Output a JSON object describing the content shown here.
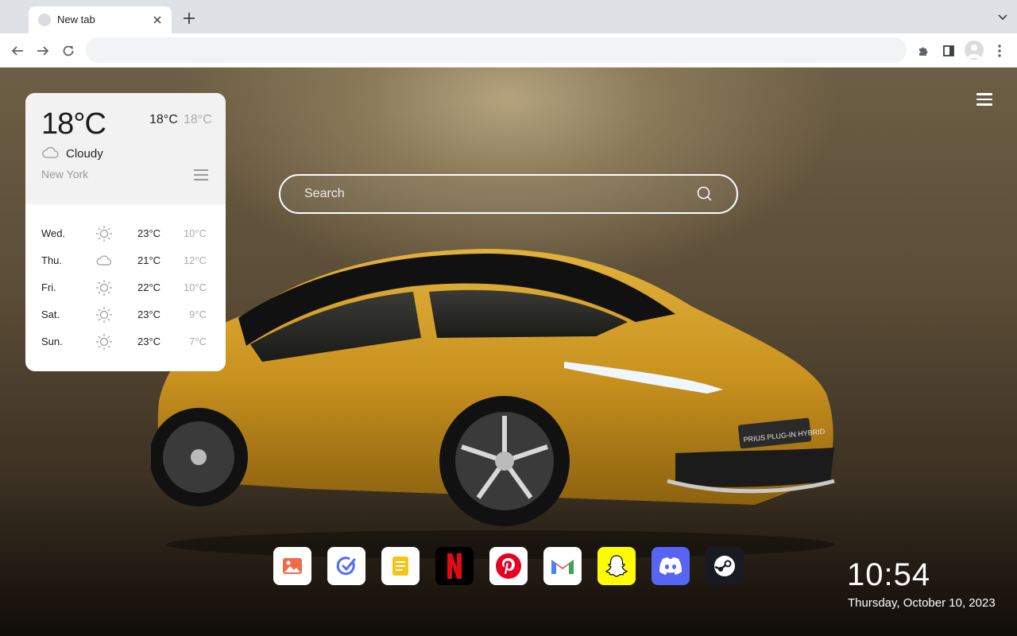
{
  "browser": {
    "tab_title": "New tab",
    "omnibox_value": "",
    "omnibox_placeholder": ""
  },
  "weather": {
    "current_temp": "18°C",
    "high": "18°C",
    "low": "18°C",
    "condition": "Cloudy",
    "condition_icon": "cloud-icon",
    "city": "New York",
    "forecast": [
      {
        "day": "Wed.",
        "icon": "sun-icon",
        "high": "23°C",
        "low": "10°C"
      },
      {
        "day": "Thu.",
        "icon": "cloud-icon",
        "high": "21°C",
        "low": "12°C"
      },
      {
        "day": "Fri.",
        "icon": "sun-icon",
        "high": "22°C",
        "low": "10°C"
      },
      {
        "day": "Sat.",
        "icon": "sun-icon",
        "high": "23°C",
        "low": "9°C"
      },
      {
        "day": "Sun.",
        "icon": "sun-icon",
        "high": "23°C",
        "low": "7°C"
      }
    ]
  },
  "search": {
    "placeholder": "Search"
  },
  "wallpaper": {
    "plate_text": "PRIUS PLUG-IN HYBRID"
  },
  "dock": {
    "apps": [
      {
        "name": "photos",
        "icon": "photos-icon",
        "bg": "#ffffff",
        "accent": "#f06a4a"
      },
      {
        "name": "tasks",
        "icon": "tasks-icon",
        "bg": "#ffffff",
        "accent": "#4f6ef7"
      },
      {
        "name": "notes",
        "icon": "notes-icon",
        "bg": "#ffffff",
        "accent": "#f5c518"
      },
      {
        "name": "netflix",
        "icon": "netflix-icon",
        "bg": "#000000",
        "accent": "#e50914"
      },
      {
        "name": "pinterest",
        "icon": "pinterest-icon",
        "bg": "#ffffff",
        "accent": "#e60023"
      },
      {
        "name": "gmail",
        "icon": "gmail-icon",
        "bg": "#ffffff",
        "accent": "#ea4335"
      },
      {
        "name": "snapchat",
        "icon": "snapchat-icon",
        "bg": "#fffc00",
        "accent": "#ffffff"
      },
      {
        "name": "discord",
        "icon": "discord-icon",
        "bg": "#5865f2",
        "accent": "#ffffff"
      },
      {
        "name": "steam",
        "icon": "steam-icon",
        "bg": "#171a21",
        "accent": "#ffffff"
      }
    ]
  },
  "clock": {
    "time": "10:54",
    "date": "Thursday, October 10, 2023"
  }
}
